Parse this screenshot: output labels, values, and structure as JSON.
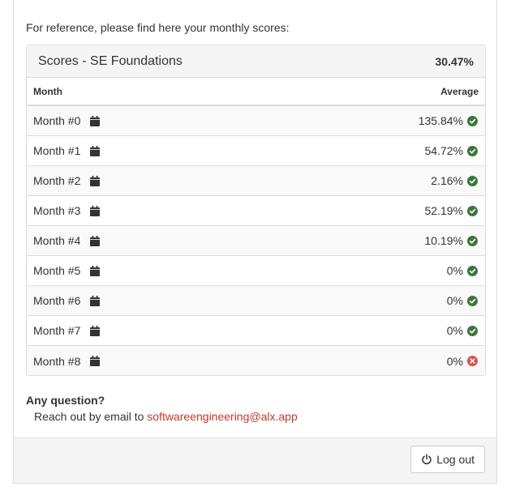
{
  "intro_text": "For reference, please find here your monthly scores:",
  "panel": {
    "title": "Scores - SE Foundations",
    "total": "30.47%"
  },
  "table": {
    "col_month": "Month",
    "col_average": "Average",
    "rows": [
      {
        "month": "Month #0",
        "average": "135.84%",
        "status": "check-circle-icon"
      },
      {
        "month": "Month #1",
        "average": "54.72%",
        "status": "check-circle-icon"
      },
      {
        "month": "Month #2",
        "average": "2.16%",
        "status": "check-circle-icon"
      },
      {
        "month": "Month #3",
        "average": "52.19%",
        "status": "check-circle-icon"
      },
      {
        "month": "Month #4",
        "average": "10.19%",
        "status": "check-circle-icon"
      },
      {
        "month": "Month #5",
        "average": "0%",
        "status": "check-circle-icon"
      },
      {
        "month": "Month #6",
        "average": "0%",
        "status": "check-circle-icon"
      },
      {
        "month": "Month #7",
        "average": "0%",
        "status": "check-circle-icon"
      },
      {
        "month": "Month #8",
        "average": "0%",
        "status": "times-circle-icon"
      }
    ]
  },
  "question": {
    "heading": "Any question?",
    "text": "Reach out by email to",
    "email": "softwareengineering@alx.app"
  },
  "footer": {
    "logout_label": "Log out"
  },
  "colors": {
    "success": "#3c763d",
    "danger": "#d9534f",
    "link": "#c0392b"
  }
}
